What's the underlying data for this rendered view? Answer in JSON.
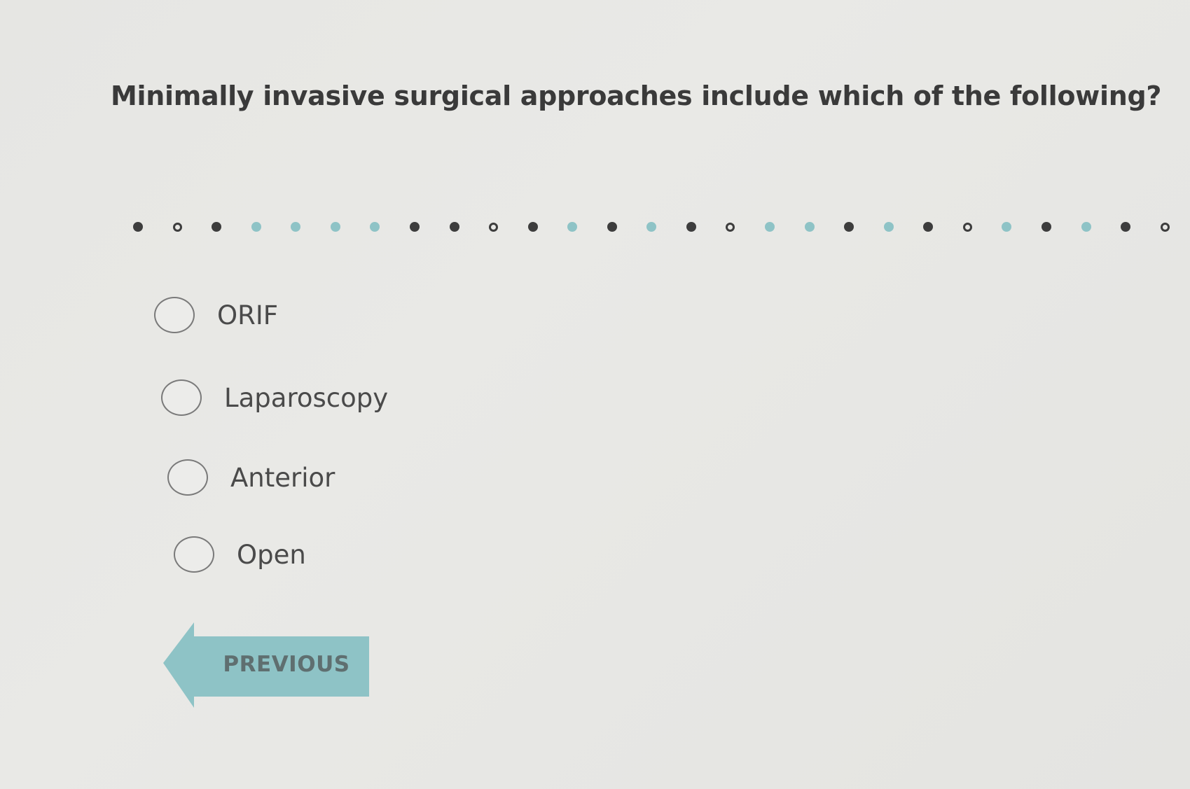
{
  "question": {
    "text": "Minimally invasive surgical approaches include which of the following?"
  },
  "progress": {
    "dots": [
      "answered",
      "current",
      "answered",
      "flagged",
      "flagged",
      "flagged",
      "flagged",
      "answered",
      "answered",
      "current",
      "answered",
      "flagged",
      "answered",
      "flagged",
      "answered",
      "current",
      "flagged",
      "flagged",
      "answered",
      "flagged",
      "answered",
      "current",
      "flagged",
      "answered",
      "flagged",
      "answered",
      "current"
    ]
  },
  "options": [
    {
      "label": "ORIF",
      "selected": false
    },
    {
      "label": "Laparoscopy",
      "selected": false
    },
    {
      "label": "Anterior",
      "selected": false
    },
    {
      "label": "Open",
      "selected": false
    }
  ],
  "navigation": {
    "previous_label": "PREVIOUS",
    "accent_color": "#8ec3c6"
  }
}
